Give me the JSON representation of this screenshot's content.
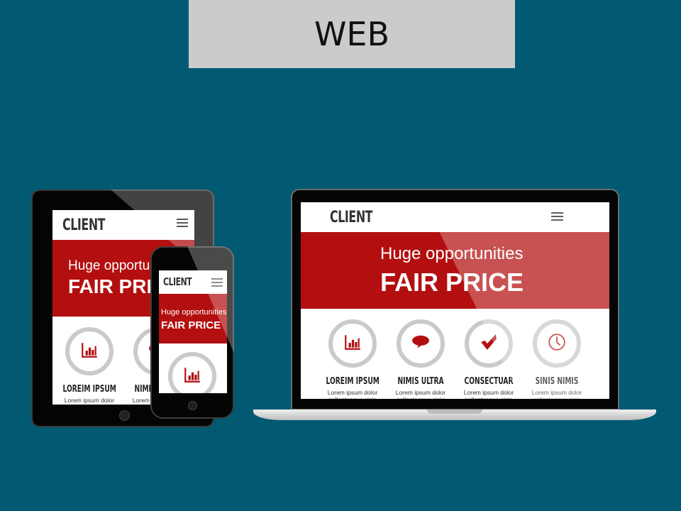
{
  "banner": {
    "title": "WEB"
  },
  "site": {
    "logo": "CLIENT",
    "hero_subtitle": "Huge opportunities",
    "hero_title": "FAIR PRICE",
    "features": [
      {
        "label": "LOREIM IPSUM",
        "text1": "Lorem ipsum dolor",
        "text2": "pellentesque sinis",
        "icon": "bar-chart-icon"
      },
      {
        "label": "NIMIS ULTRA",
        "text1": "Lorem ipsum dolor",
        "text2": "pellentesque sinis",
        "icon": "speech-bubble-icon"
      },
      {
        "label": "CONSECTUAR",
        "text1": "Lorem ipsum dolor",
        "text2": "pellentesque sinis",
        "icon": "checkmark-icon"
      },
      {
        "label": "SINIS NIMIS",
        "text1": "Lorem ipsum dolor",
        "text2": "pellentesque sinis",
        "icon": "clock-icon"
      }
    ]
  },
  "colors": {
    "background": "#025a72",
    "accent": "#b30f10",
    "banner": "#cbcbcb"
  }
}
